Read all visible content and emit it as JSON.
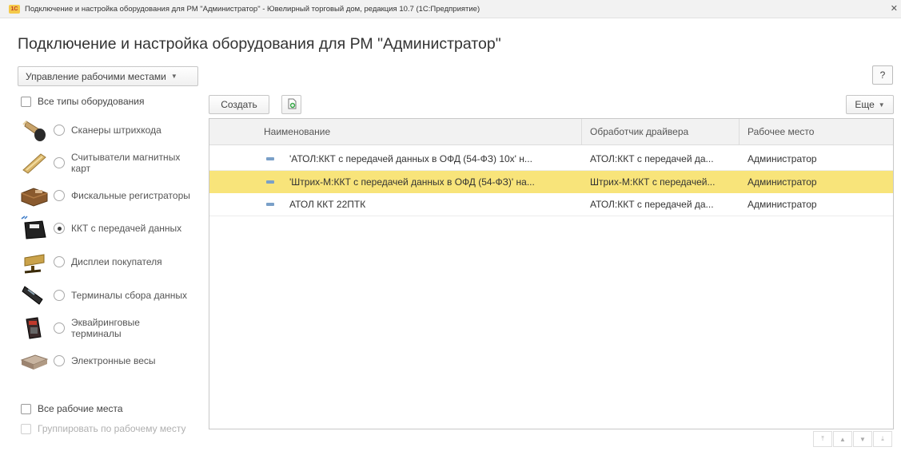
{
  "window": {
    "title": "Подключение и настройка оборудования для РМ \"Администратор\" - Ювелирный торговый дом, редакция 10.7  (1С:Предприятие)",
    "logo_text": "1С"
  },
  "page_title": "Подключение и настройка оборудования для РМ \"Администратор\"",
  "help_label": "?",
  "workplaces_button": "Управление рабочими местами",
  "all_types_label": "Все типы оборудования",
  "equipment_types": [
    {
      "label": "Сканеры штрихкода",
      "icon": "barcode-scanner-icon",
      "selected": false
    },
    {
      "label": "Считыватели магнитных карт",
      "icon": "card-reader-icon",
      "selected": false
    },
    {
      "label": "Фискальные регистраторы",
      "icon": "fiscal-register-icon",
      "selected": false
    },
    {
      "label": "ККТ с передачей данных",
      "icon": "kkt-icon",
      "selected": true
    },
    {
      "label": "Дисплеи покупателя",
      "icon": "customer-display-icon",
      "selected": false
    },
    {
      "label": "Терминалы сбора данных",
      "icon": "data-terminal-icon",
      "selected": false
    },
    {
      "label": "Эквайринговые терминалы",
      "icon": "acquiring-terminal-icon",
      "selected": false
    },
    {
      "label": "Электронные весы",
      "icon": "scales-icon",
      "selected": false
    }
  ],
  "all_workplaces_label": "Все рабочие места",
  "group_by_workplace_label": "Группировать по рабочему месту",
  "toolbar": {
    "create_label": "Создать",
    "more_label": "Еще"
  },
  "table": {
    "columns": [
      "Наименование",
      "Обработчик драйвера",
      "Рабочее место"
    ],
    "rows": [
      {
        "name": "'АТОЛ:ККТ с передачей данных в ОФД (54-ФЗ) 10х' н...",
        "driver": "АТОЛ:ККТ с передачей да...",
        "workplace": "Администратор",
        "selected": false
      },
      {
        "name": "'Штрих-М:ККТ с передачей данных в ОФД (54-ФЗ)' на...",
        "driver": "Штрих-М:ККТ с передачей...",
        "workplace": "Администратор",
        "selected": true
      },
      {
        "name": "АТОЛ ККТ 22ПТК",
        "driver": "АТОЛ:ККТ с передачей да...",
        "workplace": "Администратор",
        "selected": false
      }
    ]
  },
  "colors": {
    "selected_row": "#f8e47a",
    "row_marker": "#7aa0c8"
  }
}
